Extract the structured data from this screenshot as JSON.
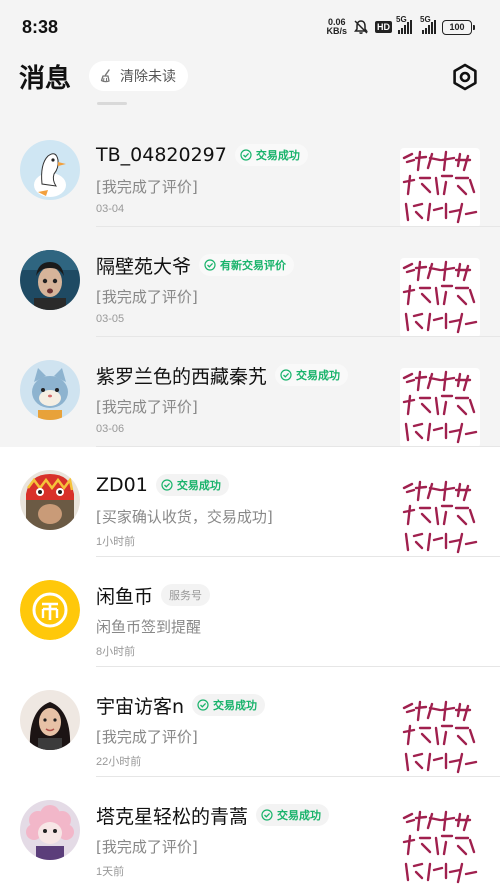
{
  "status_bar": {
    "time": "8:38",
    "speed_value": "0.06",
    "speed_unit": "KB/s",
    "hd_label": "HD",
    "sim1_label": "5G",
    "sim2_label": "5G",
    "battery": "100"
  },
  "header": {
    "title": "消息",
    "clear_unread": "清除未读",
    "settings_icon": "settings-hexagon-icon"
  },
  "colors": {
    "green_badge": "#19b36b",
    "dim_background": "#f4f4f4",
    "thumb_script": "#a0204e",
    "coin_yellow": "#ffc80a"
  },
  "conversations": [
    {
      "name": "TB_04820297",
      "badge": "交易成功",
      "badge_kind": "success",
      "message": "[我完成了评价]",
      "time": "03-04",
      "has_thumbnail": true,
      "avatar": "cartoon-goose-avatar"
    },
    {
      "name": "隔壁苑大爷",
      "badge": "有新交易评价",
      "badge_kind": "success",
      "message": "[我完成了评价]",
      "time": "03-05",
      "has_thumbnail": true,
      "avatar": "photo-avatar"
    },
    {
      "name": "紫罗兰色的西藏秦艽",
      "badge": "交易成功",
      "badge_kind": "success",
      "message": "[我完成了评价]",
      "time": "03-06",
      "has_thumbnail": true,
      "avatar": "cartoon-cat-avatar"
    },
    {
      "name": "ZD01",
      "badge": "交易成功",
      "badge_kind": "success",
      "message": "[买家确认收货，交易成功]",
      "time": "1小时前",
      "has_thumbnail": true,
      "avatar": "lion-dance-avatar"
    },
    {
      "name": "闲鱼币",
      "badge": "服务号",
      "badge_kind": "service",
      "message": "闲鱼币签到提醒",
      "time": "8小时前",
      "has_thumbnail": false,
      "avatar": "coin-icon"
    },
    {
      "name": "宇宙访客n",
      "badge": "交易成功",
      "badge_kind": "success",
      "message": "[我完成了评价]",
      "time": "22小时前",
      "has_thumbnail": true,
      "avatar": "photo-avatar"
    },
    {
      "name": "塔克星轻松的青蒿",
      "badge": "交易成功",
      "badge_kind": "success",
      "message": "[我完成了评价]",
      "time": "1天前",
      "has_thumbnail": true,
      "avatar": "cartoon-sheep-avatar"
    }
  ]
}
